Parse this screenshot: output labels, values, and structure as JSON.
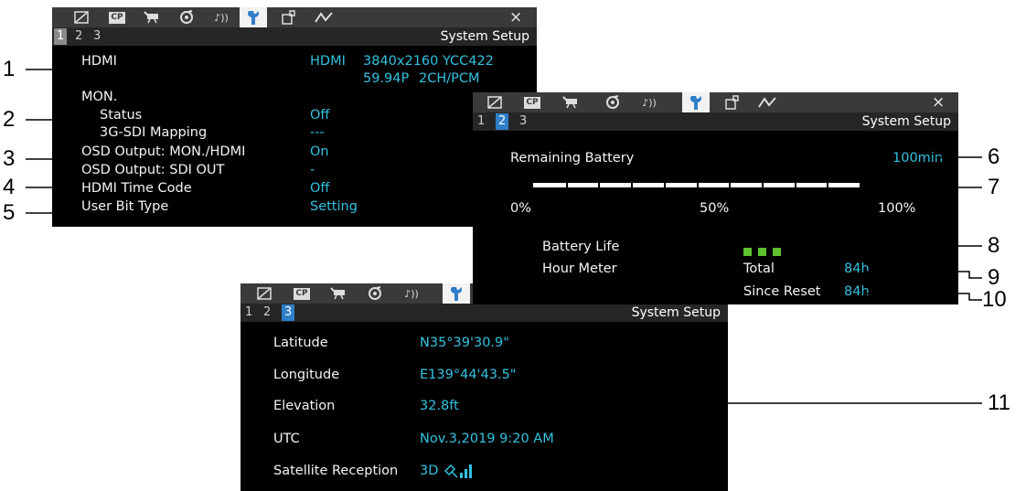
{
  "common": {
    "page_title": "System Setup",
    "pages": [
      "1",
      "2",
      "3"
    ],
    "close": "×",
    "tabs": [
      "camera-icon",
      "cp-icon",
      "recording-icon",
      "media-icon",
      "audio-icon",
      "wrench-icon",
      "assign-icon",
      "network-icon"
    ],
    "tab_cp_text": "CP",
    "audio_glyph": "♪))"
  },
  "screen1": {
    "active_page": "1",
    "hdmi": {
      "label": "HDMI",
      "v1": "HDMI",
      "v2": "3840x2160 YCC422",
      "v3": "59.94P",
      "v4": "2CH/PCM"
    },
    "mon": {
      "label": "MON.",
      "status_label": "Status",
      "status_value": "Off",
      "mapping_label": "3G-SDI Mapping",
      "mapping_value": "---"
    },
    "osd_mon": {
      "label": "OSD Output: MON./HDMI",
      "value": "On"
    },
    "osd_sdi": {
      "label": "OSD Output: SDI OUT",
      "value": "-"
    },
    "hdmi_tc": {
      "label": "HDMI Time Code",
      "value": "Off"
    },
    "user_bit": {
      "label": "User Bit Type",
      "value": "Setting"
    }
  },
  "screen2": {
    "active_page": "2",
    "remaining_label": "Remaining Battery",
    "remaining_value": "100min",
    "battery_fill": 1.0,
    "scale": [
      "0%",
      "50%",
      "100%"
    ],
    "life_label": "Battery Life",
    "life_level": 3,
    "hour_label": "Hour Meter",
    "total_label": "Total",
    "total_value": "84h",
    "reset_label": "Since Reset",
    "reset_value": "84h"
  },
  "screen3": {
    "active_page": "3",
    "latitude_label": "Latitude",
    "latitude_value": "N35°39'30.9\"",
    "longitude_label": "Longitude",
    "longitude_value": "E139°44'43.5\"",
    "elevation_label": "Elevation",
    "elevation_value": "32.8ft",
    "utc_label": "UTC",
    "utc_value": "Nov.3,2019 9:20 AM",
    "sat_label": "Satellite Reception",
    "sat_value": "3D",
    "sat_icon": "satellite-signal-icon"
  },
  "callouts": [
    "1",
    "2",
    "3",
    "4",
    "5",
    "6",
    "7",
    "8",
    "9",
    "10",
    "11"
  ],
  "colors": {
    "screen_bg": "#000000",
    "value_cyan": "#33c2e0",
    "active_page_blue": "#2f7ec9",
    "battery_green": "#5ec12e"
  }
}
